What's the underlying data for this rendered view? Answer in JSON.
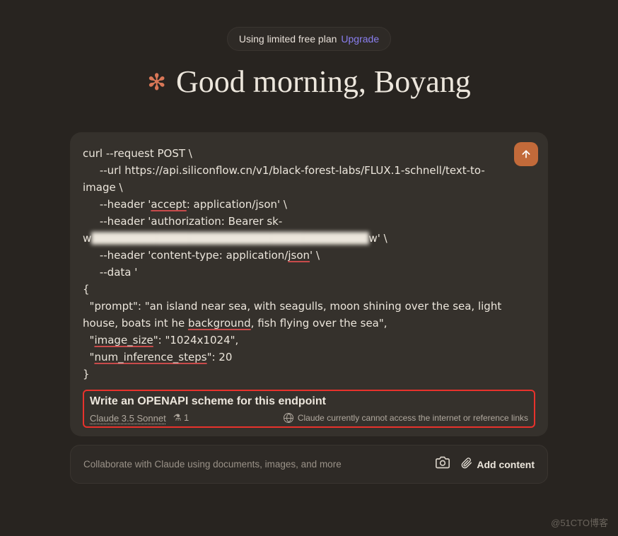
{
  "plan": {
    "text": "Using limited free plan",
    "upgrade": "Upgrade"
  },
  "greeting": {
    "text": "Good morning, Boyang"
  },
  "code": {
    "line1": "curl --request POST \\",
    "line2_pre": "     --url https://api.siliconflow.cn/v1/black-forest-labs/FLUX.1-schnell/text-to-image \\",
    "line3_pre": "     --header '",
    "line3_ul": "accept",
    "line3_post": ": application/json' \\",
    "line4": "     --header 'authorization: Bearer sk-",
    "line5_pre": "w",
    "line5_blur": "██████████████████████████████████",
    "line5_post": "w' \\",
    "line6_pre": "     --header 'content-type: application/",
    "line6_ul": "json",
    "line6_post": "' \\",
    "line7": "     --data '",
    "line8": "{",
    "line9_pre": "  \"prompt\": \"an island near sea, with seagulls, moon shining over the sea, light house, boats int he ",
    "line9_ul": "background",
    "line9_post": ", fish flying over the sea\",",
    "line10_pre": "  \"",
    "line10_ul": "image_size",
    "line10_post": "\": \"1024x1024\",",
    "line11_pre": "  \"",
    "line11_ul": "num_inference_steps",
    "line11_post": "\": 20",
    "line12": "}"
  },
  "query": {
    "text": "Write an OPENAPI scheme for this endpoint"
  },
  "meta": {
    "model": "Claude 3.5 Sonnet",
    "flask_count": "1",
    "warning": "Claude currently cannot access the internet or reference links"
  },
  "bottom": {
    "collab": "Collaborate with Claude using documents, images, and more",
    "add": "Add content"
  },
  "watermark": "@51CTO博客"
}
